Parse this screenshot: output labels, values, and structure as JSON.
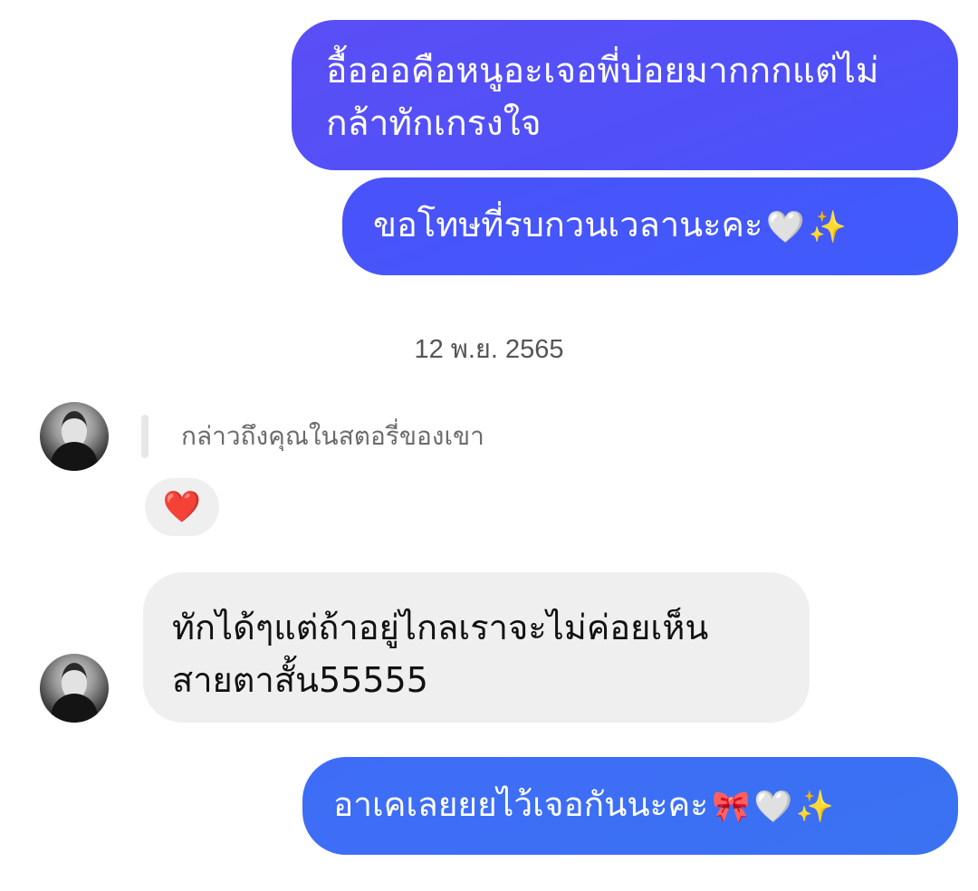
{
  "messages": {
    "sent_1": "อื้อออคือหนูอะเจอพี่บ่อยมากกกแต่ไม่กล้าทักเกรงใจ",
    "sent_2_text": "ขอโทษที่รบกวนเวลานะคะ",
    "sent_2_emoji": [
      "🤍",
      "✨"
    ],
    "date_separator": "12 พ.ย. 2565",
    "story_mention": "กล่าวถึงคุณในสตอรี่ของเขา",
    "reaction_emoji": "❤️",
    "received_1": "ทักได้ๆแต่ถ้าอยู่ไกลเราจะไม่ค่อยเห็นสายตาสั้น55555",
    "sent_3_text": "อาเคเลยยยไว้เจอกันนะคะ",
    "sent_3_emoji": [
      "🎀",
      "🤍",
      "✨"
    ]
  },
  "colors": {
    "sent_bubble_top": "#5b4ef5",
    "sent_bubble_bottom": "#3a72f2",
    "received_bubble": "#efefef",
    "date_text": "#555555"
  },
  "icons": {
    "avatar": "user-avatar-photo",
    "reaction": "red-heart-emoji"
  }
}
